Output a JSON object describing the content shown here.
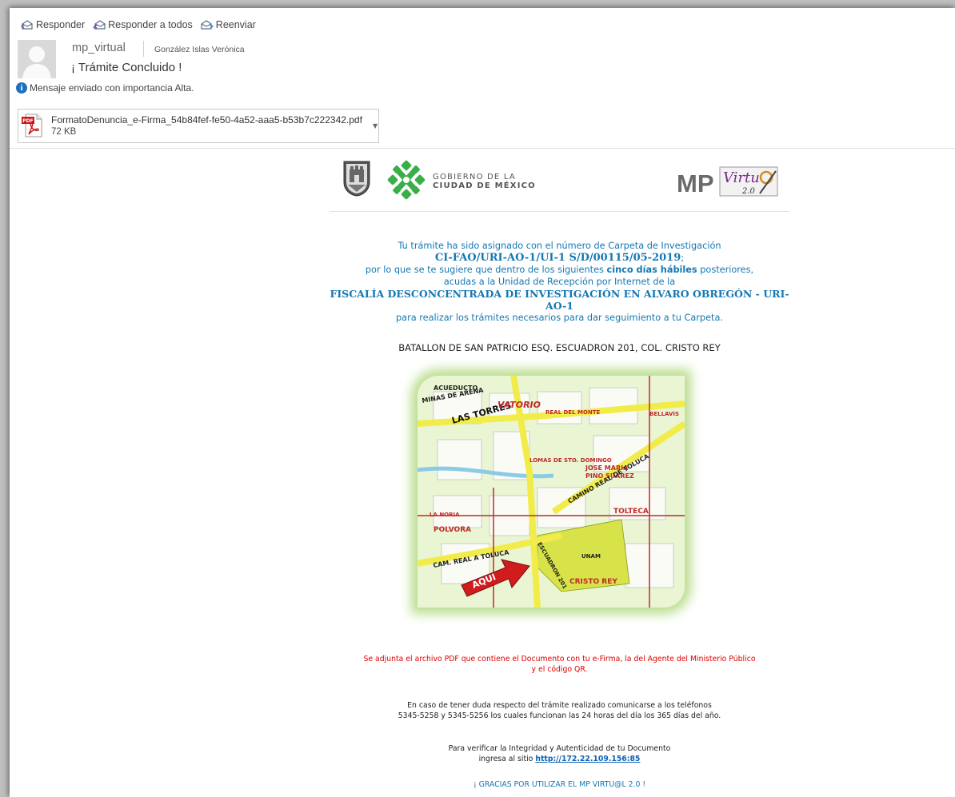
{
  "toolbar": {
    "reply_label": "Responder",
    "reply_all_label": "Responder a todos",
    "forward_label": "Reenviar"
  },
  "header": {
    "sender": "mp_virtual",
    "recipient": "González Islas Verónica",
    "subject": "¡ Trámite Concluido !",
    "importance": "Mensaje enviado con importancia Alta."
  },
  "attachment": {
    "name": "FormatoDenuncia_e-Firma_54b84fef-fe50-4a52-aaa5-b53b7c222342.pdf",
    "size": "72 KB",
    "type_badge": "PDF"
  },
  "logos": {
    "gov_line1": "GOBIERNO DE LA",
    "gov_line2": "CIUDAD DE MÉXICO",
    "mp_brand": "MP",
    "mp_script": "Virtu",
    "mp_version": "2.0"
  },
  "body": {
    "line1": "Tu trámite ha sido asignado con el número de Carpeta de Investigación",
    "folder_number": "CI-FAO/URI-AO-1/UI-1 S/D/00115/05-2019",
    "folder_suffix": ";",
    "line3_before": "por lo que se te sugiere que dentro de los siguientes ",
    "line3_bold": "cinco días hábiles",
    "line3_after": " posteriores,",
    "line4": "acudas a la Unidad de Recepción por Internet de la",
    "fiscalia": "FISCALÍA DESCONCENTRADA DE INVESTIGACIÓN EN ALVARO OBREGÓN - URI-AO-1",
    "line6": "para realizar los trámites necesarios para dar seguimiento a tu Carpeta.",
    "address": "BATALLON DE SAN PATRICIO ESQ. ESCUADRON 201, COL. CRISTO REY"
  },
  "map": {
    "labels": {
      "acueducto": "ACUEDUCTO",
      "minas": "MINAS DE ARENA",
      "torres": "LAS TORRES",
      "vatorio": "VATORIO",
      "jose_maria": "JOSE MARIA",
      "pino_suarez": "PINO SUAREZ",
      "real_monte": "REAL DEL MONTE",
      "lomas": "LOMAS DE STO. DOMINGO",
      "camino_real": "CAMINO REAL DE TOLUCA",
      "tolteca": "TOLTECA",
      "polvora": "POLVORA",
      "cam_real": "CAM. REAL A TOLUCA",
      "cristo_rey": "CRISTO REY",
      "bellavis": "BELLAVIS",
      "aqui": "AQUI",
      "la_noria": "LA NORIA",
      "unam": "UNAM",
      "escuadron": "ESCUADRON 201"
    },
    "colors": {
      "park": "#d7e348",
      "road": "#f2ec4a",
      "avenue": "#c02a2a",
      "water": "#8ccbe8"
    }
  },
  "footer": {
    "notice_line1": "Se adjunta el archivo PDF que contiene el Documento con tu e-Firma, la del Agente del Ministerio Público",
    "notice_line2": "y el código QR.",
    "contact_line1": "En caso de tener duda respecto del trámite realizado comunicarse a los teléfonos",
    "contact_line2": "5345-5258 y 5345-5256 los cuales funcionan las 24 horas del día los 365 días del año.",
    "verify_line1": "Para verificar la Integridad y Autenticidad de tu Documento",
    "verify_prefix": "ingresa al sitio ",
    "verify_link": "http://172.22.109.156:85",
    "thanks": "¡ GRACIAS POR UTILIZAR EL MP VIRTU@L 2.0 !"
  },
  "colors": {
    "accent_blue": "#1478b3",
    "notice_red": "#e00000",
    "link_blue": "#0b63b5",
    "cdmx_green": "#3aae49"
  }
}
